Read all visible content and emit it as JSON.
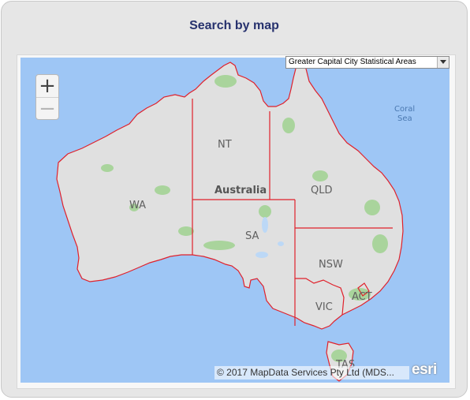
{
  "panel": {
    "title": "Search by map"
  },
  "region_select": {
    "selected": "Greater Capital City Statistical Areas"
  },
  "zoom": {
    "in_label": "+",
    "out_label": "−"
  },
  "map_labels": {
    "country": "Australia",
    "sea": "Coral\nSea",
    "sea_line1": "Coral",
    "sea_line2": "Sea",
    "states": [
      "WA",
      "NT",
      "SA",
      "QLD",
      "NSW",
      "VIC",
      "ACT",
      "TAS"
    ]
  },
  "attribution": "© 2017 MapData Services Pty Ltd (MDS...",
  "logo": "esri",
  "colors": {
    "water": "#9ec6f5",
    "land": "#e0e0e0",
    "boundary": "#e0212b",
    "park": "#a9d49c",
    "title": "#27326e"
  }
}
